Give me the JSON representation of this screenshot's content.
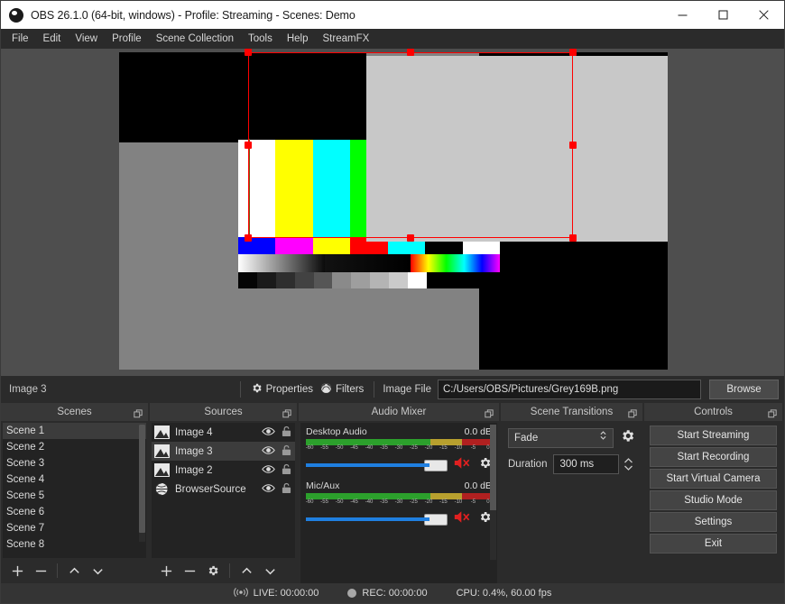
{
  "window": {
    "title": "OBS 26.1.0 (64-bit, windows) - Profile: Streaming - Scenes: Demo",
    "app_icon": "obs-logo-icon",
    "minimize_label": "Minimize",
    "maximize_label": "Maximize",
    "close_label": "Close"
  },
  "menu": {
    "items": [
      {
        "label": "File"
      },
      {
        "label": "Edit"
      },
      {
        "label": "View"
      },
      {
        "label": "Profile"
      },
      {
        "label": "Scene Collection"
      },
      {
        "label": "Tools"
      },
      {
        "label": "Help"
      },
      {
        "label": "StreamFX"
      }
    ]
  },
  "source_toolbar": {
    "selected_source": "Image 3",
    "properties_label": "Properties",
    "filters_label": "Filters",
    "image_file_label": "Image File",
    "image_file_value": "C:/Users/OBS/Pictures/Grey169B.png",
    "browse_label": "Browse"
  },
  "scenes": {
    "title": "Scenes",
    "items": [
      {
        "label": "Scene 1",
        "selected": true
      },
      {
        "label": "Scene 2",
        "selected": false
      },
      {
        "label": "Scene 3",
        "selected": false
      },
      {
        "label": "Scene 4",
        "selected": false
      },
      {
        "label": "Scene 5",
        "selected": false
      },
      {
        "label": "Scene 6",
        "selected": false
      },
      {
        "label": "Scene 7",
        "selected": false
      },
      {
        "label": "Scene 8",
        "selected": false
      }
    ],
    "toolbar": [
      "add",
      "remove",
      "move-up",
      "move-down"
    ]
  },
  "sources": {
    "title": "Sources",
    "items": [
      {
        "label": "Image 4",
        "icon": "image-icon",
        "visible": true,
        "locked": false,
        "selected": false
      },
      {
        "label": "Image 3",
        "icon": "image-icon",
        "visible": true,
        "locked": false,
        "selected": true
      },
      {
        "label": "Image 2",
        "icon": "image-icon",
        "visible": true,
        "locked": false,
        "selected": false
      },
      {
        "label": "BrowserSource",
        "icon": "globe-icon",
        "visible": true,
        "locked": false,
        "selected": false
      }
    ],
    "toolbar": [
      "add",
      "remove",
      "properties",
      "move-up",
      "move-down"
    ]
  },
  "audio_mixer": {
    "title": "Audio Mixer",
    "tracks": [
      {
        "name": "Desktop Audio",
        "db": "0.0 dB",
        "muted": true,
        "ticks": [
          "-60",
          "-55",
          "-50",
          "-45",
          "-40",
          "-35",
          "-30",
          "-25",
          "-20",
          "-15",
          "-10",
          "-5",
          "0"
        ]
      },
      {
        "name": "Mic/Aux",
        "db": "0.0 dB",
        "muted": true,
        "ticks": [
          "-60",
          "-55",
          "-50",
          "-45",
          "-40",
          "-35",
          "-30",
          "-25",
          "-20",
          "-15",
          "-10",
          "-5",
          "0"
        ]
      }
    ]
  },
  "scene_transitions": {
    "title": "Scene Transitions",
    "transition": "Fade",
    "duration_label": "Duration",
    "duration_value": "300 ms"
  },
  "controls": {
    "title": "Controls",
    "buttons": [
      {
        "label": "Start Streaming"
      },
      {
        "label": "Start Recording"
      },
      {
        "label": "Start Virtual Camera"
      },
      {
        "label": "Studio Mode"
      },
      {
        "label": "Settings"
      },
      {
        "label": "Exit"
      }
    ]
  },
  "status_bar": {
    "live_label": "LIVE: 00:00:00",
    "rec_label": "REC: 00:00:00",
    "cpu_label": "CPU: 0.4%, 60.00 fps"
  },
  "preview": {
    "selection_color": "#ff0000",
    "canvas_bg": "#000000",
    "grey_source_color": "#828282",
    "selected_source_color": "#c8c8c8",
    "color_bars": [
      "#ffffff",
      "#ffff00",
      "#00ffff",
      "#00ff00",
      "#ff00ff",
      "#ff0000",
      "#0000ff"
    ],
    "mid_bars": [
      "#0000ff",
      "#ff00ff",
      "#ffff00",
      "#ff0000",
      "#00ffff",
      "#000000",
      "#ffffff"
    ],
    "step_bars": [
      "#050505",
      "#1a1a1a",
      "#2e2e2e",
      "#424242",
      "#565656",
      "#8a8a8a",
      "#9e9e9e",
      "#b4b4b4",
      "#cacaca",
      "#ffffff"
    ]
  }
}
